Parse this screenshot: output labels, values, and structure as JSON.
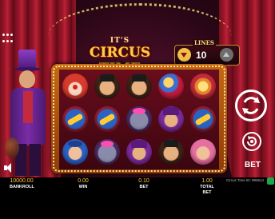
{
  "game": {
    "title_top": "IT'S",
    "title_main": "CIRCUS TIME",
    "identifier": "Circus Time ID: 990614"
  },
  "lines": {
    "label": "LINES",
    "value": "10"
  },
  "reels": [
    [
      "clown",
      "man",
      "man",
      "ball",
      "ring"
    ],
    [
      "cannon",
      "cannon",
      "elephant",
      "purple",
      "cannon"
    ],
    [
      "boy",
      "elephant",
      "purple",
      "man",
      "woman"
    ]
  ],
  "controls": {
    "bet_label": "BET"
  },
  "stats": {
    "bankroll": {
      "value": "10000.00",
      "label": "BANKROLL"
    },
    "win": {
      "value": "0.00",
      "label": "WIN"
    },
    "bet": {
      "value": "0.10",
      "label": "BET"
    },
    "total_bet": {
      "value": "1.00",
      "label": "TOTAL BET"
    }
  },
  "colors": {
    "gold": "#ffcc33",
    "background": "#2a0716",
    "frame": "#c46a14"
  },
  "icons": [
    "menu-icon",
    "spin-icon",
    "autoplay-icon",
    "sound-icon",
    "lines-down-icon",
    "lines-up-icon"
  ]
}
